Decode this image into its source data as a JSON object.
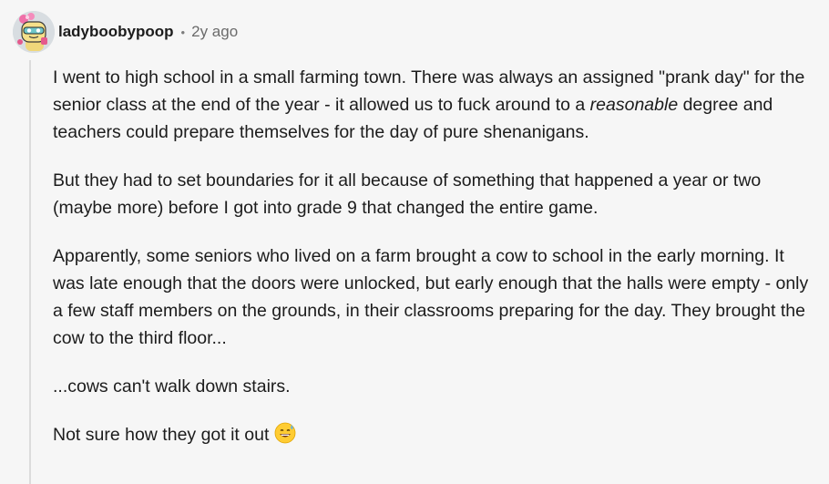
{
  "comment": {
    "author": "ladyboobypoop",
    "separator": "•",
    "timestamp": "2y ago",
    "paragraphs": {
      "p1_a": "I went to high school in a small farming town. There was always an assigned \"prank day\" for the senior class at the end of the year - it allowed us to fuck around to a ",
      "p1_em": "reasonable",
      "p1_b": " degree and teachers could prepare themselves for the day of pure shenanigans.",
      "p2": "But they had to set boundaries for it all because of something that happened a year or two (maybe more) before I got into grade 9 that changed the entire game.",
      "p3": "Apparently, some seniors who lived on a farm brought a cow to school in the early morning. It was late enough that the doors were unlocked, but early enough that the halls were empty - only a few staff members on the grounds, in their classrooms preparing for the day. They brought the cow to the third floor...",
      "p4": "...cows can't walk down stairs.",
      "p5": "Not sure how they got it out"
    },
    "emoji": "grinning-sweat-emoji"
  },
  "colors": {
    "background": "#f6f6f6",
    "text": "#1c1c1c",
    "muted": "#6b6b6b",
    "thread_line": "#dcdcdc",
    "avatar_bg": "#d8dde1"
  }
}
